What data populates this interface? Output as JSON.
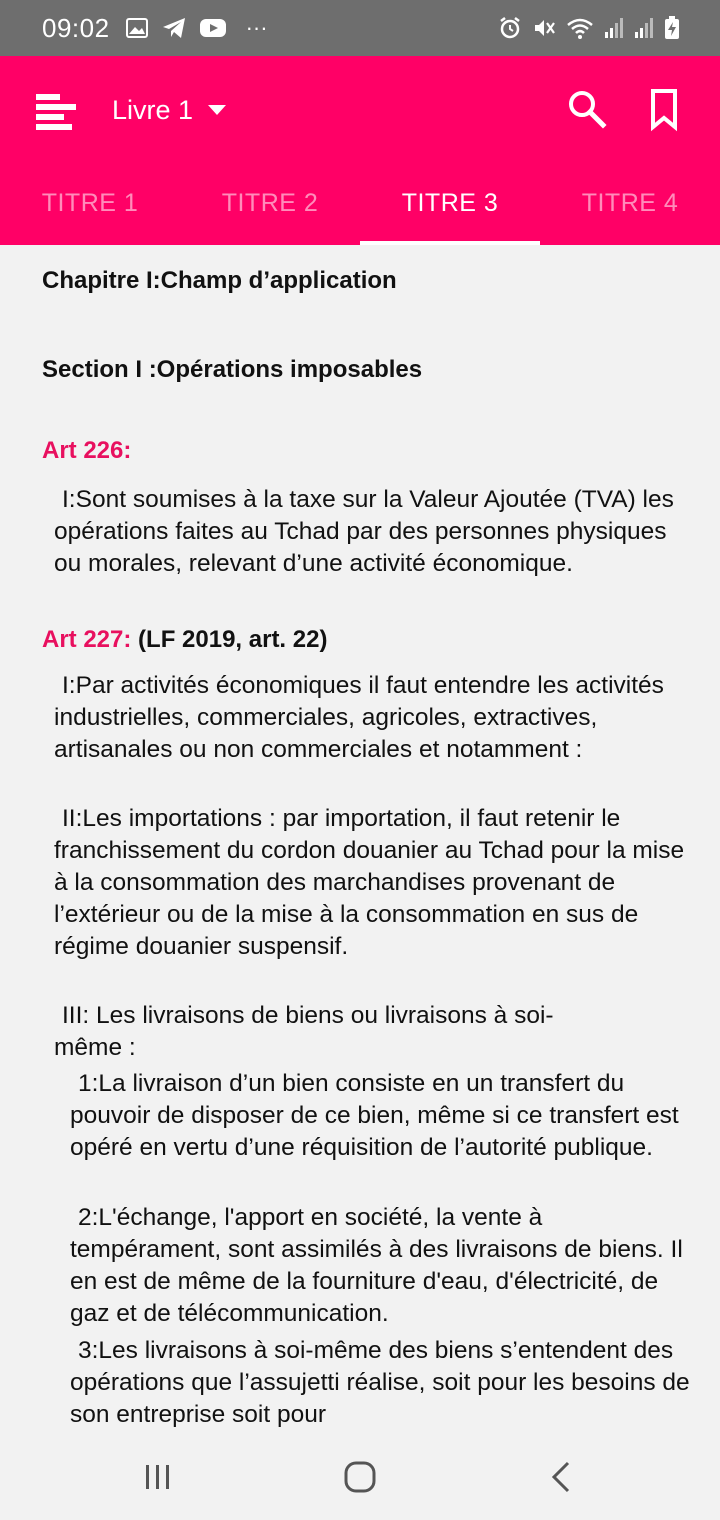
{
  "status_bar": {
    "time": "09:02",
    "notification_icons": [
      "gallery-icon",
      "telegram-icon",
      "youtube-icon",
      "more-icon"
    ],
    "system_icons": [
      "alarm-icon",
      "mute-icon",
      "wifi-icon",
      "signal-icon",
      "signal-icon",
      "battery-charging-icon"
    ],
    "more": "···"
  },
  "app_bar": {
    "book_label": "Livre 1",
    "accent_color": "#ff0066"
  },
  "tabs": [
    {
      "label": "TITRE 1",
      "active": false
    },
    {
      "label": "TITRE 2",
      "active": false
    },
    {
      "label": "TITRE 3",
      "active": true
    },
    {
      "label": "TITRE 4",
      "active": false
    }
  ],
  "content": {
    "chapter": "Chapitre I:Champ d’application",
    "section": "Section I :Opérations imposables",
    "art226": {
      "label": "Art 226:",
      "p1": "I:Sont soumises à la taxe sur la Valeur Ajoutée (TVA) les opérations faites au Tchad par des personnes physiques ou morales, relevant d’une activité économique."
    },
    "art227": {
      "label": "Art 227:",
      "ref": "(LF 2019, art. 22)",
      "p1": "I:Par activités économiques il faut entendre les activités industrielles, commerciales, agricoles, extractives, artisanales ou non commerciales et notamment :",
      "p2": "II:Les importations : par importation, il faut retenir le franchissement du cordon douanier au Tchad pour la mise à la consommation des marchandises provenant de l’extérieur ou de la mise à la consommation en sus de régime douanier suspensif.",
      "p3": "III: Les livraisons de biens ou livraisons à soi-même :",
      "s1": "1:La livraison d’un bien consiste en un transfert du pouvoir de disposer de ce bien, même si ce transfert est opéré en vertu d’une réquisition de l’autorité publique.",
      "s2": "2:L'échange, l'apport en société, la vente à tempérament, sont assimilés à des livraisons de biens. Il en est de même de la fourniture d'eau, d'électricité, de gaz et de télécommunication.",
      "s3": "3:Les livraisons à soi-même des biens s’entendent des opérations que l’assujetti réalise, soit pour les besoins de son entreprise soit pour"
    }
  },
  "nav_bar": {
    "buttons": [
      "recents-icon",
      "home-icon",
      "back-icon"
    ]
  }
}
